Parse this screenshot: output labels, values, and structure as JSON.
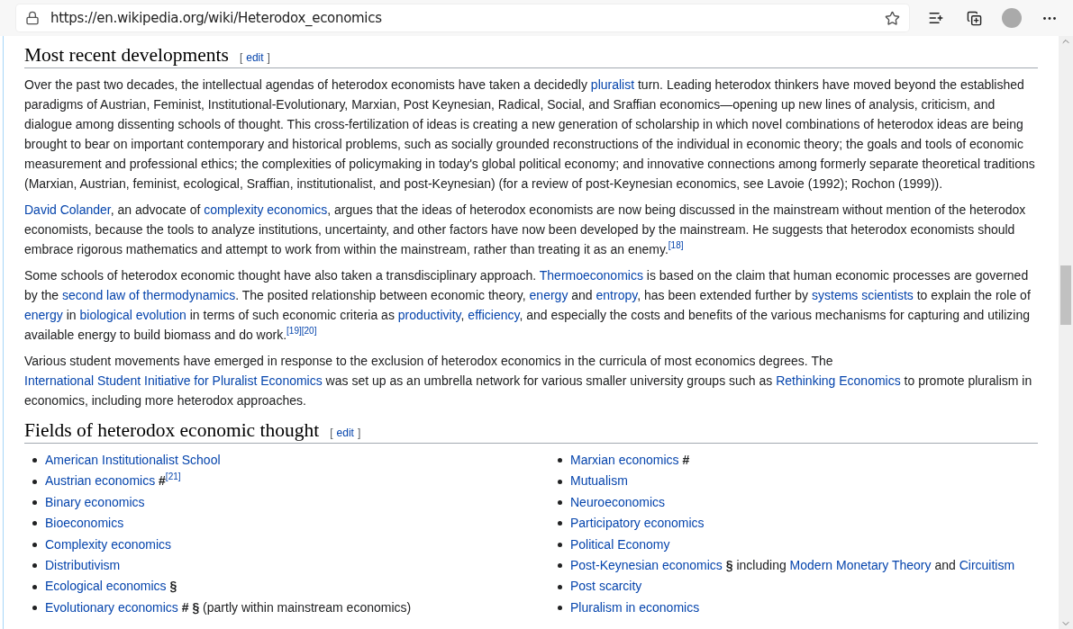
{
  "browser": {
    "url": "https://en.wikipedia.org/wiki/Heterodox_economics"
  },
  "sections": [
    {
      "title": "Most recent developments",
      "edit": {
        "open": "[",
        "label": "edit",
        "close": "]"
      },
      "paragraphs": [
        [
          {
            "kind": "text",
            "text": "Over the past two decades, the intellectual agendas of heterodox economists have taken a decidedly "
          },
          {
            "kind": "link",
            "text": "pluralist"
          },
          {
            "kind": "text",
            "text": " turn. Leading heterodox thinkers have moved beyond the established paradigms of Austrian, Feminist, Institutional-Evolutionary, Marxian, Post Keynesian, Radical, Social, and Sraffian economics—opening up new lines of analysis, criticism, and dialogue among dissenting schools of thought. This cross-fertilization of ideas is creating a new generation of scholarship in which novel combinations of heterodox ideas are being brought to bear on important contemporary and historical problems, such as socially grounded reconstructions of the individual in economic theory; the goals and tools of economic measurement and professional ethics; the complexities of policymaking in today's global political economy; and innovative connections among formerly separate theoretical traditions (Marxian, Austrian, feminist, ecological, Sraffian, institutionalist, and post-Keynesian) (for a review of post-Keynesian economics, see Lavoie (1992); Rochon (1999))."
          }
        ],
        [
          {
            "kind": "link",
            "text": "David Colander"
          },
          {
            "kind": "text",
            "text": ", an advocate of "
          },
          {
            "kind": "link",
            "text": "complexity economics"
          },
          {
            "kind": "text",
            "text": ", argues that the ideas of heterodox economists are now being discussed in the mainstream without mention of the heterodox economists, because the tools to analyze institutions, uncertainty, and other factors have now been developed by the mainstream. He suggests that heterodox economists should embrace rigorous mathematics and attempt to work from within the mainstream, rather than treating it as an enemy."
          },
          {
            "kind": "cite",
            "text": "[18]"
          }
        ],
        [
          {
            "kind": "text",
            "text": "Some schools of heterodox economic thought have also taken a transdisciplinary approach. "
          },
          {
            "kind": "link",
            "text": "Thermoeconomics"
          },
          {
            "kind": "text",
            "text": " is based on the claim that human economic processes are governed by the "
          },
          {
            "kind": "link",
            "text": "second law of thermodynamics"
          },
          {
            "kind": "text",
            "text": ". The posited relationship between economic theory, "
          },
          {
            "kind": "link",
            "text": "energy"
          },
          {
            "kind": "text",
            "text": " and "
          },
          {
            "kind": "link",
            "text": "entropy"
          },
          {
            "kind": "text",
            "text": ", has been extended further by "
          },
          {
            "kind": "link",
            "text": "systems scientists"
          },
          {
            "kind": "text",
            "text": " to explain the role of "
          },
          {
            "kind": "link",
            "text": "energy"
          },
          {
            "kind": "text",
            "text": " in "
          },
          {
            "kind": "link",
            "text": "biological evolution"
          },
          {
            "kind": "text",
            "text": " in terms of such economic criteria as "
          },
          {
            "kind": "link",
            "text": "productivity"
          },
          {
            "kind": "text",
            "text": ", "
          },
          {
            "kind": "link",
            "text": "efficiency"
          },
          {
            "kind": "text",
            "text": ", and especially the costs and benefits of the various mechanisms for capturing and utilizing available energy to build biomass and do work."
          },
          {
            "kind": "cite",
            "text": "[19]"
          },
          {
            "kind": "cite",
            "text": "[20]"
          }
        ],
        [
          {
            "kind": "text",
            "text": "Various student movements have emerged in response to the exclusion of heterodox economics in the curricula of most economics degrees. The "
          },
          {
            "kind": "link",
            "text": "International Student Initiative for Pluralist Economics"
          },
          {
            "kind": "text",
            "text": " was set up as an umbrella network for various smaller university groups such as "
          },
          {
            "kind": "link",
            "text": "Rethinking Economics"
          },
          {
            "kind": "text",
            "text": " to promote pluralism in economics, including more heterodox approaches."
          }
        ]
      ]
    },
    {
      "title": "Fields of heterodox economic thought",
      "edit": {
        "open": "[",
        "label": "edit",
        "close": "]"
      },
      "columns": [
        [
          [
            {
              "kind": "link",
              "text": "American Institutionalist School"
            }
          ],
          [
            {
              "kind": "link",
              "text": "Austrian economics"
            },
            {
              "kind": "text",
              "text": " **#**"
            },
            {
              "kind": "cite",
              "text": "[21]"
            }
          ],
          [
            {
              "kind": "link",
              "text": "Binary economics"
            }
          ],
          [
            {
              "kind": "link",
              "text": "Bioeconomics"
            }
          ],
          [
            {
              "kind": "link",
              "text": "Complexity economics"
            }
          ],
          [
            {
              "kind": "link",
              "text": "Distributivism"
            }
          ],
          [
            {
              "kind": "link",
              "text": "Ecological economics"
            },
            {
              "kind": "text",
              "text": " **§**"
            }
          ],
          [
            {
              "kind": "link",
              "text": "Evolutionary economics"
            },
            {
              "kind": "text",
              "text": " **# §** (partly within mainstream economics)"
            }
          ]
        ],
        [
          [
            {
              "kind": "link",
              "text": "Marxian economics"
            },
            {
              "kind": "text",
              "text": " **#**"
            }
          ],
          [
            {
              "kind": "link",
              "text": "Mutualism"
            }
          ],
          [
            {
              "kind": "link",
              "text": "Neuroeconomics"
            }
          ],
          [
            {
              "kind": "link",
              "text": "Participatory economics"
            }
          ],
          [
            {
              "kind": "link",
              "text": "Political Economy"
            }
          ],
          [
            {
              "kind": "link",
              "text": "Post-Keynesian economics"
            },
            {
              "kind": "text",
              "text": " **§** including "
            },
            {
              "kind": "link",
              "text": "Modern Monetary Theory"
            },
            {
              "kind": "text",
              "text": " and "
            },
            {
              "kind": "link",
              "text": "Circuitism"
            }
          ],
          [
            {
              "kind": "link",
              "text": "Post scarcity"
            }
          ],
          [
            {
              "kind": "link",
              "text": "Pluralism in economics"
            }
          ]
        ]
      ]
    }
  ]
}
